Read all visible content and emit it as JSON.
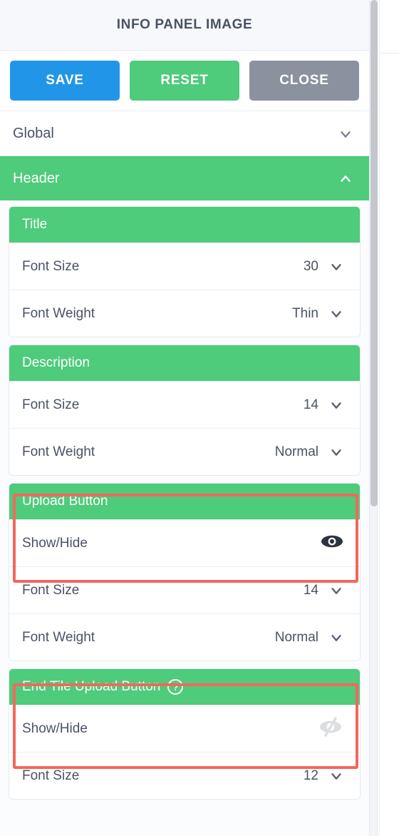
{
  "window": {
    "title": "INFO PANEL IMAGE"
  },
  "toolbar": {
    "save_label": "SAVE",
    "reset_label": "RESET",
    "close_label": "CLOSE",
    "save_color": "#2196e8",
    "reset_color": "#4ecb7b",
    "close_color": "#8b919e"
  },
  "accordions": [
    {
      "label": "Global",
      "expanded": false,
      "chevron": "chevron-down-icon"
    },
    {
      "label": "Header",
      "expanded": true,
      "chevron": "chevron-up-icon"
    }
  ],
  "sections": [
    {
      "title": "Title",
      "help": null,
      "highlighted": false,
      "rows": [
        {
          "label": "Font Size",
          "value": "30",
          "control": "dropdown"
        },
        {
          "label": "Font Weight",
          "value": "Thin",
          "control": "dropdown"
        }
      ]
    },
    {
      "title": "Description",
      "help": null,
      "highlighted": false,
      "rows": [
        {
          "label": "Font Size",
          "value": "14",
          "control": "dropdown"
        },
        {
          "label": "Font Weight",
          "value": "Normal",
          "control": "dropdown"
        }
      ]
    },
    {
      "title": "Upload Button",
      "help": null,
      "highlighted": true,
      "rows": [
        {
          "label": "Show/Hide",
          "value": "",
          "control": "eye-visible"
        },
        {
          "label": "Font Size",
          "value": "14",
          "control": "dropdown"
        },
        {
          "label": "Font Weight",
          "value": "Normal",
          "control": "dropdown"
        }
      ]
    },
    {
      "title": "End Tile Upload Button",
      "help": "?",
      "highlighted": true,
      "rows": [
        {
          "label": "Show/Hide",
          "value": "",
          "control": "eye-hidden"
        },
        {
          "label": "Font Size",
          "value": "12",
          "control": "dropdown"
        }
      ]
    }
  ],
  "colors": {
    "accent_green": "#4ecb7b",
    "annotation_red": "#f4675c",
    "text": "#4a5264",
    "titlebar_bg": "#f7f8fc"
  },
  "scrollbar": {
    "thumb_position": "top",
    "orientation": "vertical"
  }
}
